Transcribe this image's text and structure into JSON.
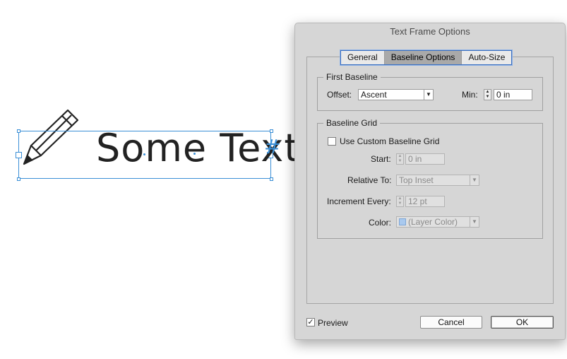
{
  "canvas": {
    "sample_text": "Some Text",
    "overflow_marker": "#"
  },
  "dialog": {
    "title": "Text Frame Options",
    "tabs": [
      {
        "label": "General",
        "active": false
      },
      {
        "label": "Baseline Options",
        "active": true
      },
      {
        "label": "Auto-Size",
        "active": false
      }
    ],
    "first_baseline": {
      "legend": "First Baseline",
      "offset_label": "Offset:",
      "offset_value": "Ascent",
      "min_label": "Min:",
      "min_value": "0 in"
    },
    "baseline_grid": {
      "legend": "Baseline Grid",
      "use_custom_label": "Use Custom Baseline Grid",
      "use_custom_checked": false,
      "start_label": "Start:",
      "start_value": "0 in",
      "relative_to_label": "Relative To:",
      "relative_to_value": "Top Inset",
      "increment_label": "Increment Every:",
      "increment_value": "12 pt",
      "color_label": "Color:",
      "color_value": "(Layer Color)",
      "color_swatch": "#a9c9ee"
    },
    "preview_label": "Preview",
    "preview_checked": true,
    "cancel_label": "Cancel",
    "ok_label": "OK"
  }
}
